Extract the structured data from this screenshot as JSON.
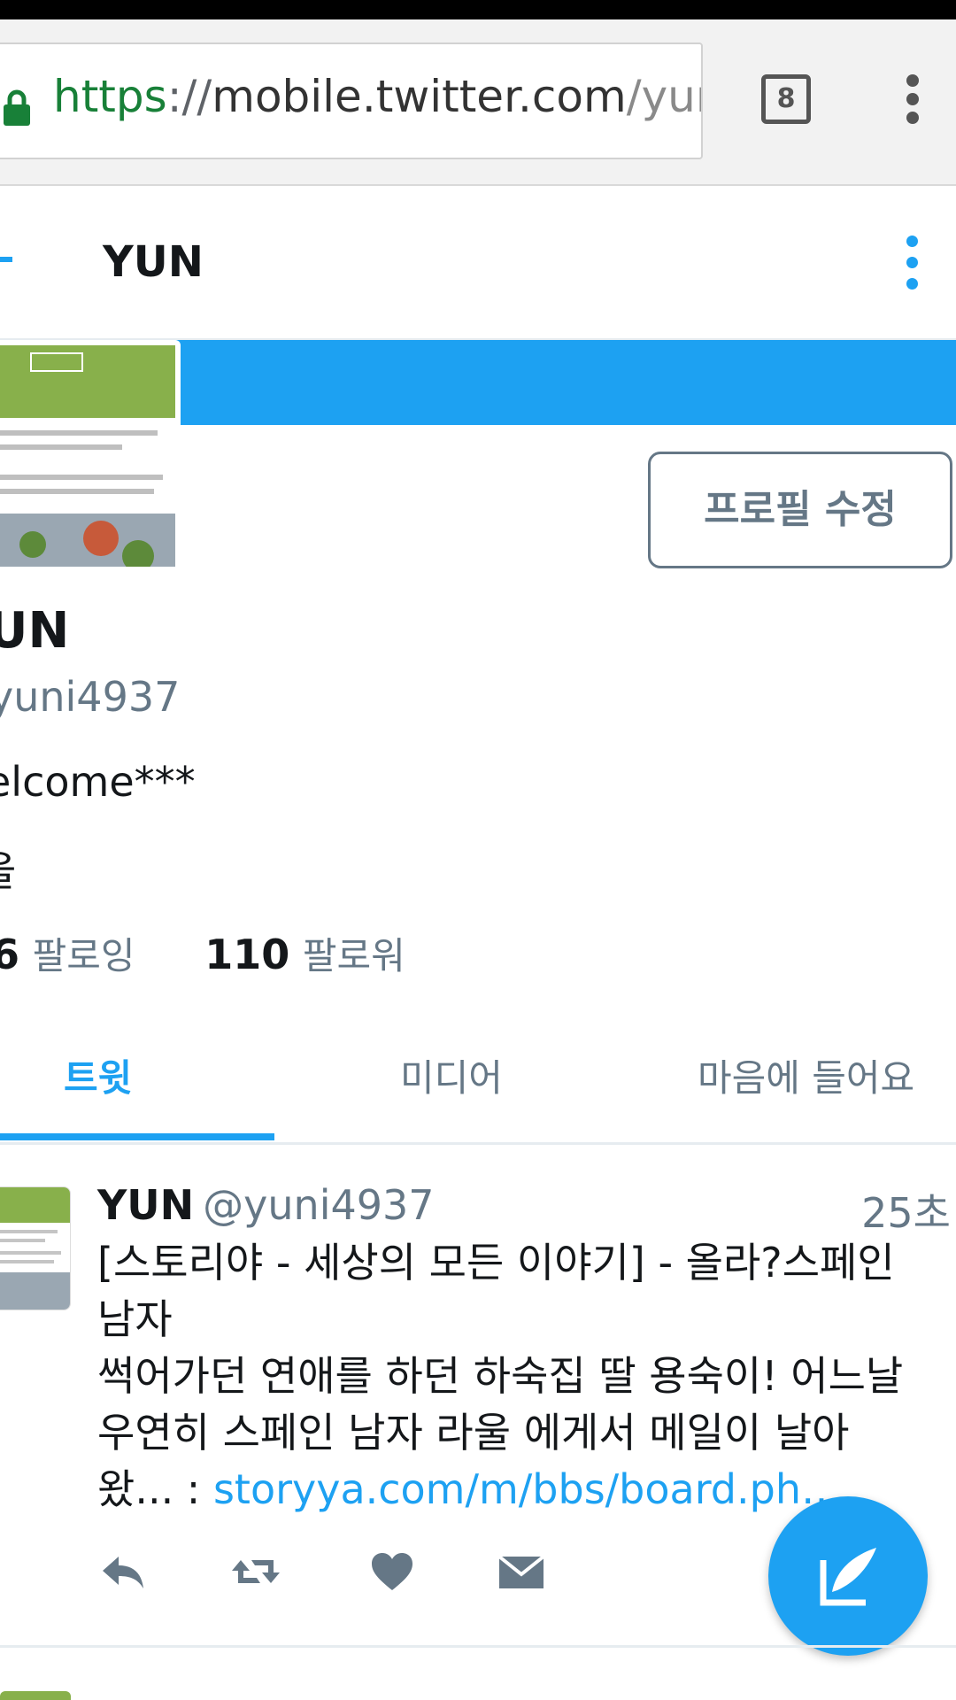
{
  "browser": {
    "url_scheme": "https",
    "url_sep": "://",
    "url_host": "mobile.twitter.com",
    "url_path": "/yur",
    "tab_count": "8"
  },
  "header": {
    "title": "YUN"
  },
  "profile": {
    "name": "UN",
    "handle": "yuni4937",
    "bio": "elcome***",
    "location": "울",
    "following_count": "6",
    "following_label": "팔로잉",
    "followers_count": "110",
    "followers_label": "팔로워",
    "edit_button": "프로필 수정"
  },
  "tabs": [
    {
      "label": "트윗",
      "active": true
    },
    {
      "label": "미디어",
      "active": false
    },
    {
      "label": "마음에 들어요",
      "active": false
    }
  ],
  "tweet": {
    "author": "YUN",
    "handle": "@yuni4937",
    "time": "25초",
    "line1": "[스토리야 - 세상의 모든 이야기] - 올라?스페인",
    "line2": "남자",
    "line3": "썩어가던 연애를 하던 하숙집 딸 용숙이! 어느날",
    "line4": "우연히 스페인 남자 라울 에게서 메일이 날아",
    "line5_prefix": "왔...  : ",
    "link": "storyya.com/m/bbs/board.ph…"
  },
  "colors": {
    "accent": "#1da1f2",
    "secondary_text": "#657786",
    "avatar_green": "#88b04b"
  },
  "icons": [
    "lock-icon",
    "tabs-icon",
    "more-vert-icon",
    "back-arrow-icon",
    "reply-icon",
    "retweet-icon",
    "like-icon",
    "direct-message-icon",
    "compose-tweet-icon"
  ]
}
